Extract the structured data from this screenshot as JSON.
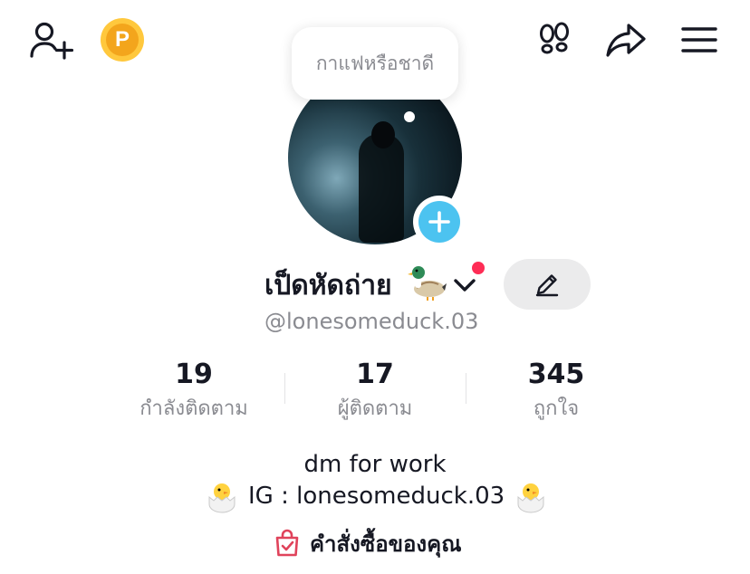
{
  "header": {
    "coin_letter": "P"
  },
  "profile": {
    "status_bubble": "กาแฟหรือชาดี",
    "display_name": "เป็ดหัดถ่าย",
    "username": "@lonesomeduck.03"
  },
  "stats": [
    {
      "value": "19",
      "label": "กำลังติดตาม"
    },
    {
      "value": "17",
      "label": "ผู้ติดตาม"
    },
    {
      "value": "345",
      "label": "ถูกใจ"
    }
  ],
  "bio": {
    "line1": "dm for work",
    "line2": "IG : lonesomeduck.03"
  },
  "orders": {
    "label": "คำสั่งซื้อของคุณ"
  },
  "icons": {
    "add_friend": "add-user-icon",
    "coin": "coin-icon",
    "footprint": "footprint-icon",
    "share": "share-icon",
    "menu": "menu-icon",
    "avatar_add": "plus-icon",
    "name_dropdown": "chevron-down-icon",
    "edit": "pencil-icon",
    "orders": "shopping-bag-icon",
    "name_emoji": "duck-emoji",
    "bio_emoji": "hatching-chick-emoji"
  },
  "colors": {
    "accent_blue": "#4cc3f0",
    "notification_red": "#fe2c55",
    "coin_gold": "#f3a51c",
    "orders_icon": "#e0435b",
    "muted_text": "#8a8b91"
  }
}
